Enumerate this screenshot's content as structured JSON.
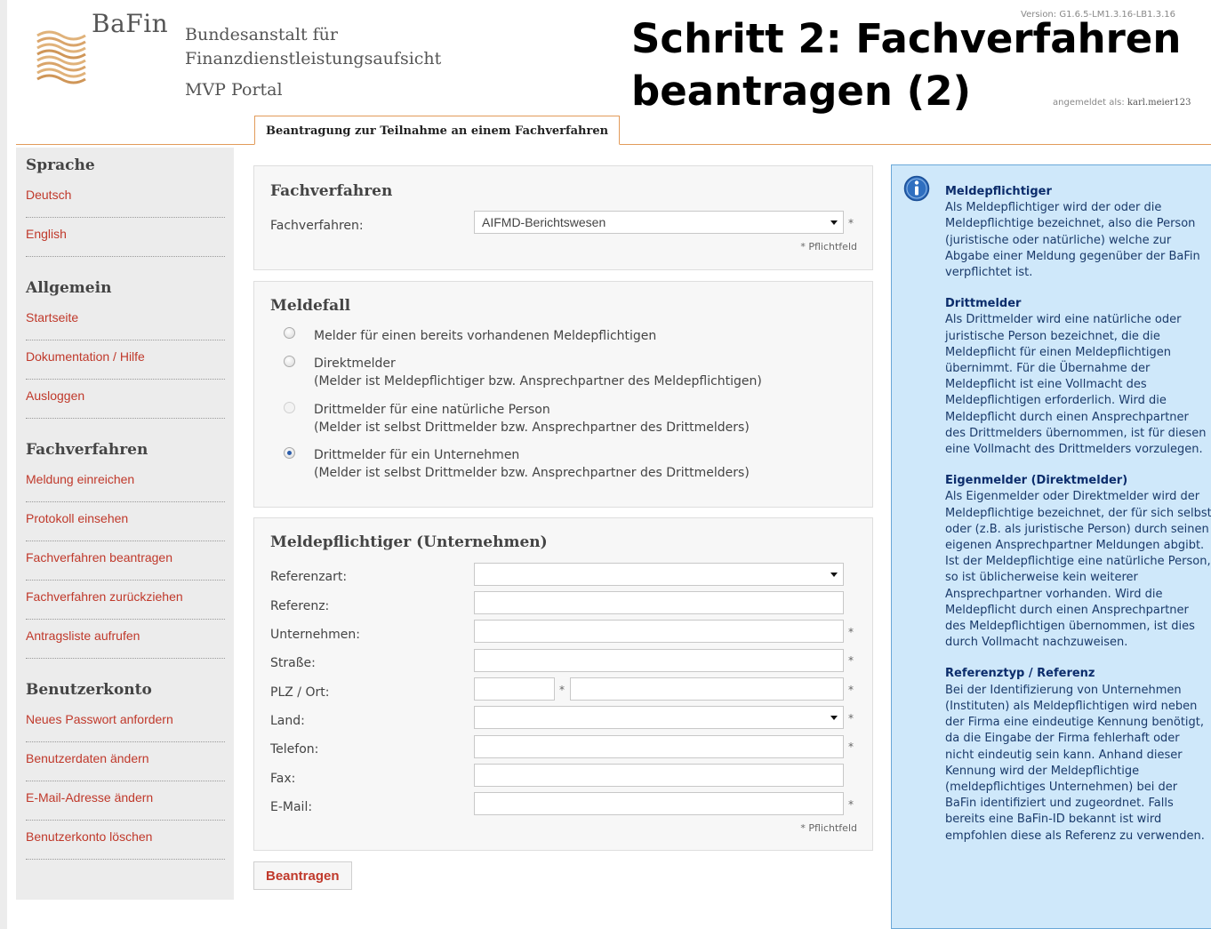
{
  "header": {
    "brand": "BaFin",
    "institution_line1": "Bundesanstalt für",
    "institution_line2": "Finanzdienstleistungsaufsicht",
    "portal": "MVP Portal",
    "version": "Version: G1.6.5-LM1.3.16-LB1.3.16",
    "headline_line1": "Schritt 2: Fachverfahren",
    "headline_line2": "beantragen (2)",
    "loggedin_label": "angemeldet als:",
    "loggedin_user": "karl.meier123",
    "tab": "Beantragung zur Teilnahme an einem Fachverfahren"
  },
  "sidebar": {
    "sections": [
      {
        "title": "Sprache",
        "items": [
          "Deutsch",
          "English"
        ]
      },
      {
        "title": "Allgemein",
        "items": [
          "Startseite",
          "Dokumentation / Hilfe",
          "Ausloggen"
        ]
      },
      {
        "title": "Fachverfahren",
        "items": [
          "Meldung einreichen",
          "Protokoll einsehen",
          "Fachverfahren beantragen",
          "Fachverfahren zurückziehen",
          "Antragsliste aufrufen"
        ]
      },
      {
        "title": "Benutzerkonto",
        "items": [
          "Neues Passwort anfordern",
          "Benutzerdaten ändern",
          "E-Mail-Adresse ändern",
          "Benutzerkonto löschen"
        ]
      }
    ]
  },
  "fachverfahren": {
    "title": "Fachverfahren",
    "label": "Fachverfahren:",
    "value": "AIFMD-Berichtswesen",
    "required_marker": "*",
    "required_note": "* Pflichtfeld"
  },
  "meldefall": {
    "title": "Meldefall",
    "selected_index": 3,
    "options": [
      {
        "line1": "Melder für einen bereits vorhandenen Meldepflichtigen",
        "line2": "",
        "disabled": false
      },
      {
        "line1": "Direktmelder",
        "line2": "(Melder ist Meldepflichtiger bzw. Ansprechpartner des Meldepflichtigen)",
        "disabled": false
      },
      {
        "line1": "Drittmelder für eine natürliche Person",
        "line2": "(Melder ist selbst Drittmelder bzw. Ansprechpartner des Drittmelders)",
        "disabled": true
      },
      {
        "line1": "Drittmelder für ein Unternehmen",
        "line2": "(Melder ist selbst Drittmelder bzw. Ansprechpartner des Drittmelders)",
        "disabled": false
      }
    ]
  },
  "meldepflichtiger": {
    "title": "Meldepflichtiger (Unternehmen)",
    "fields": {
      "referenzart": {
        "label": "Referenzart:",
        "value": ""
      },
      "referenz": {
        "label": "Referenz:",
        "value": ""
      },
      "unternehmen": {
        "label": "Unternehmen:",
        "value": ""
      },
      "strasse": {
        "label": "Straße:",
        "value": ""
      },
      "plz_ort": {
        "label": "PLZ / Ort:",
        "plz": "",
        "ort": ""
      },
      "land": {
        "label": "Land:",
        "value": ""
      },
      "telefon": {
        "label": "Telefon:",
        "value": ""
      },
      "fax": {
        "label": "Fax:",
        "value": ""
      },
      "email": {
        "label": "E-Mail:",
        "value": ""
      }
    },
    "required_marker": "*",
    "required_note": "* Pflichtfeld"
  },
  "submit_label": "Beantragen",
  "info": {
    "sections": [
      {
        "title": "Meldepflichtiger",
        "text": "Als Meldepflichtiger wird der oder die Meldepflichtige bezeichnet, also die Person (juristische oder natürliche) welche zur Abgabe einer Meldung gegenüber der BaFin verpflichtet ist."
      },
      {
        "title": "Drittmelder",
        "text": "Als Drittmelder wird eine natürliche oder juristische Person bezeichnet, die die Meldepflicht für einen Meldepflichtigen übernimmt. Für die Übernahme der Meldepflicht ist eine Vollmacht des Meldepflichtigen erforderlich. Wird die Meldepflicht durch einen Ansprechpartner des Drittmelders übernommen, ist für diesen eine Vollmacht des Drittmelders vorzulegen."
      },
      {
        "title": "Eigenmelder (Direktmelder)",
        "text": "Als Eigenmelder oder Direktmelder wird der Meldepflichtige bezeichnet, der für sich selbst oder (z.B. als juristische Person) durch seinen eigenen Ansprechpartner Meldungen abgibt. Ist der Meldepflichtige eine natürliche Person, so ist üblicherweise kein weiterer Ansprechpartner vorhanden. Wird die Meldepflicht durch einen Ansprechpartner des Meldepflichtigen übernommen, ist dies durch Vollmacht nachzuweisen."
      },
      {
        "title": "Referenztyp / Referenz",
        "text": "Bei der Identifizierung von Unternehmen (Instituten) als Meldepflichtigen wird neben der Firma eine eindeutige Kennung benötigt, da die Eingabe der Firma fehlerhaft oder nicht eindeutig sein kann. Anhand dieser Kennung wird der Meldepflichtige (meldepflichtiges Unternehmen) bei der BaFin identifiziert und zugeordnet. Falls bereits eine BaFin-ID bekannt ist wird empfohlen diese als Referenz zu verwenden."
      }
    ]
  }
}
